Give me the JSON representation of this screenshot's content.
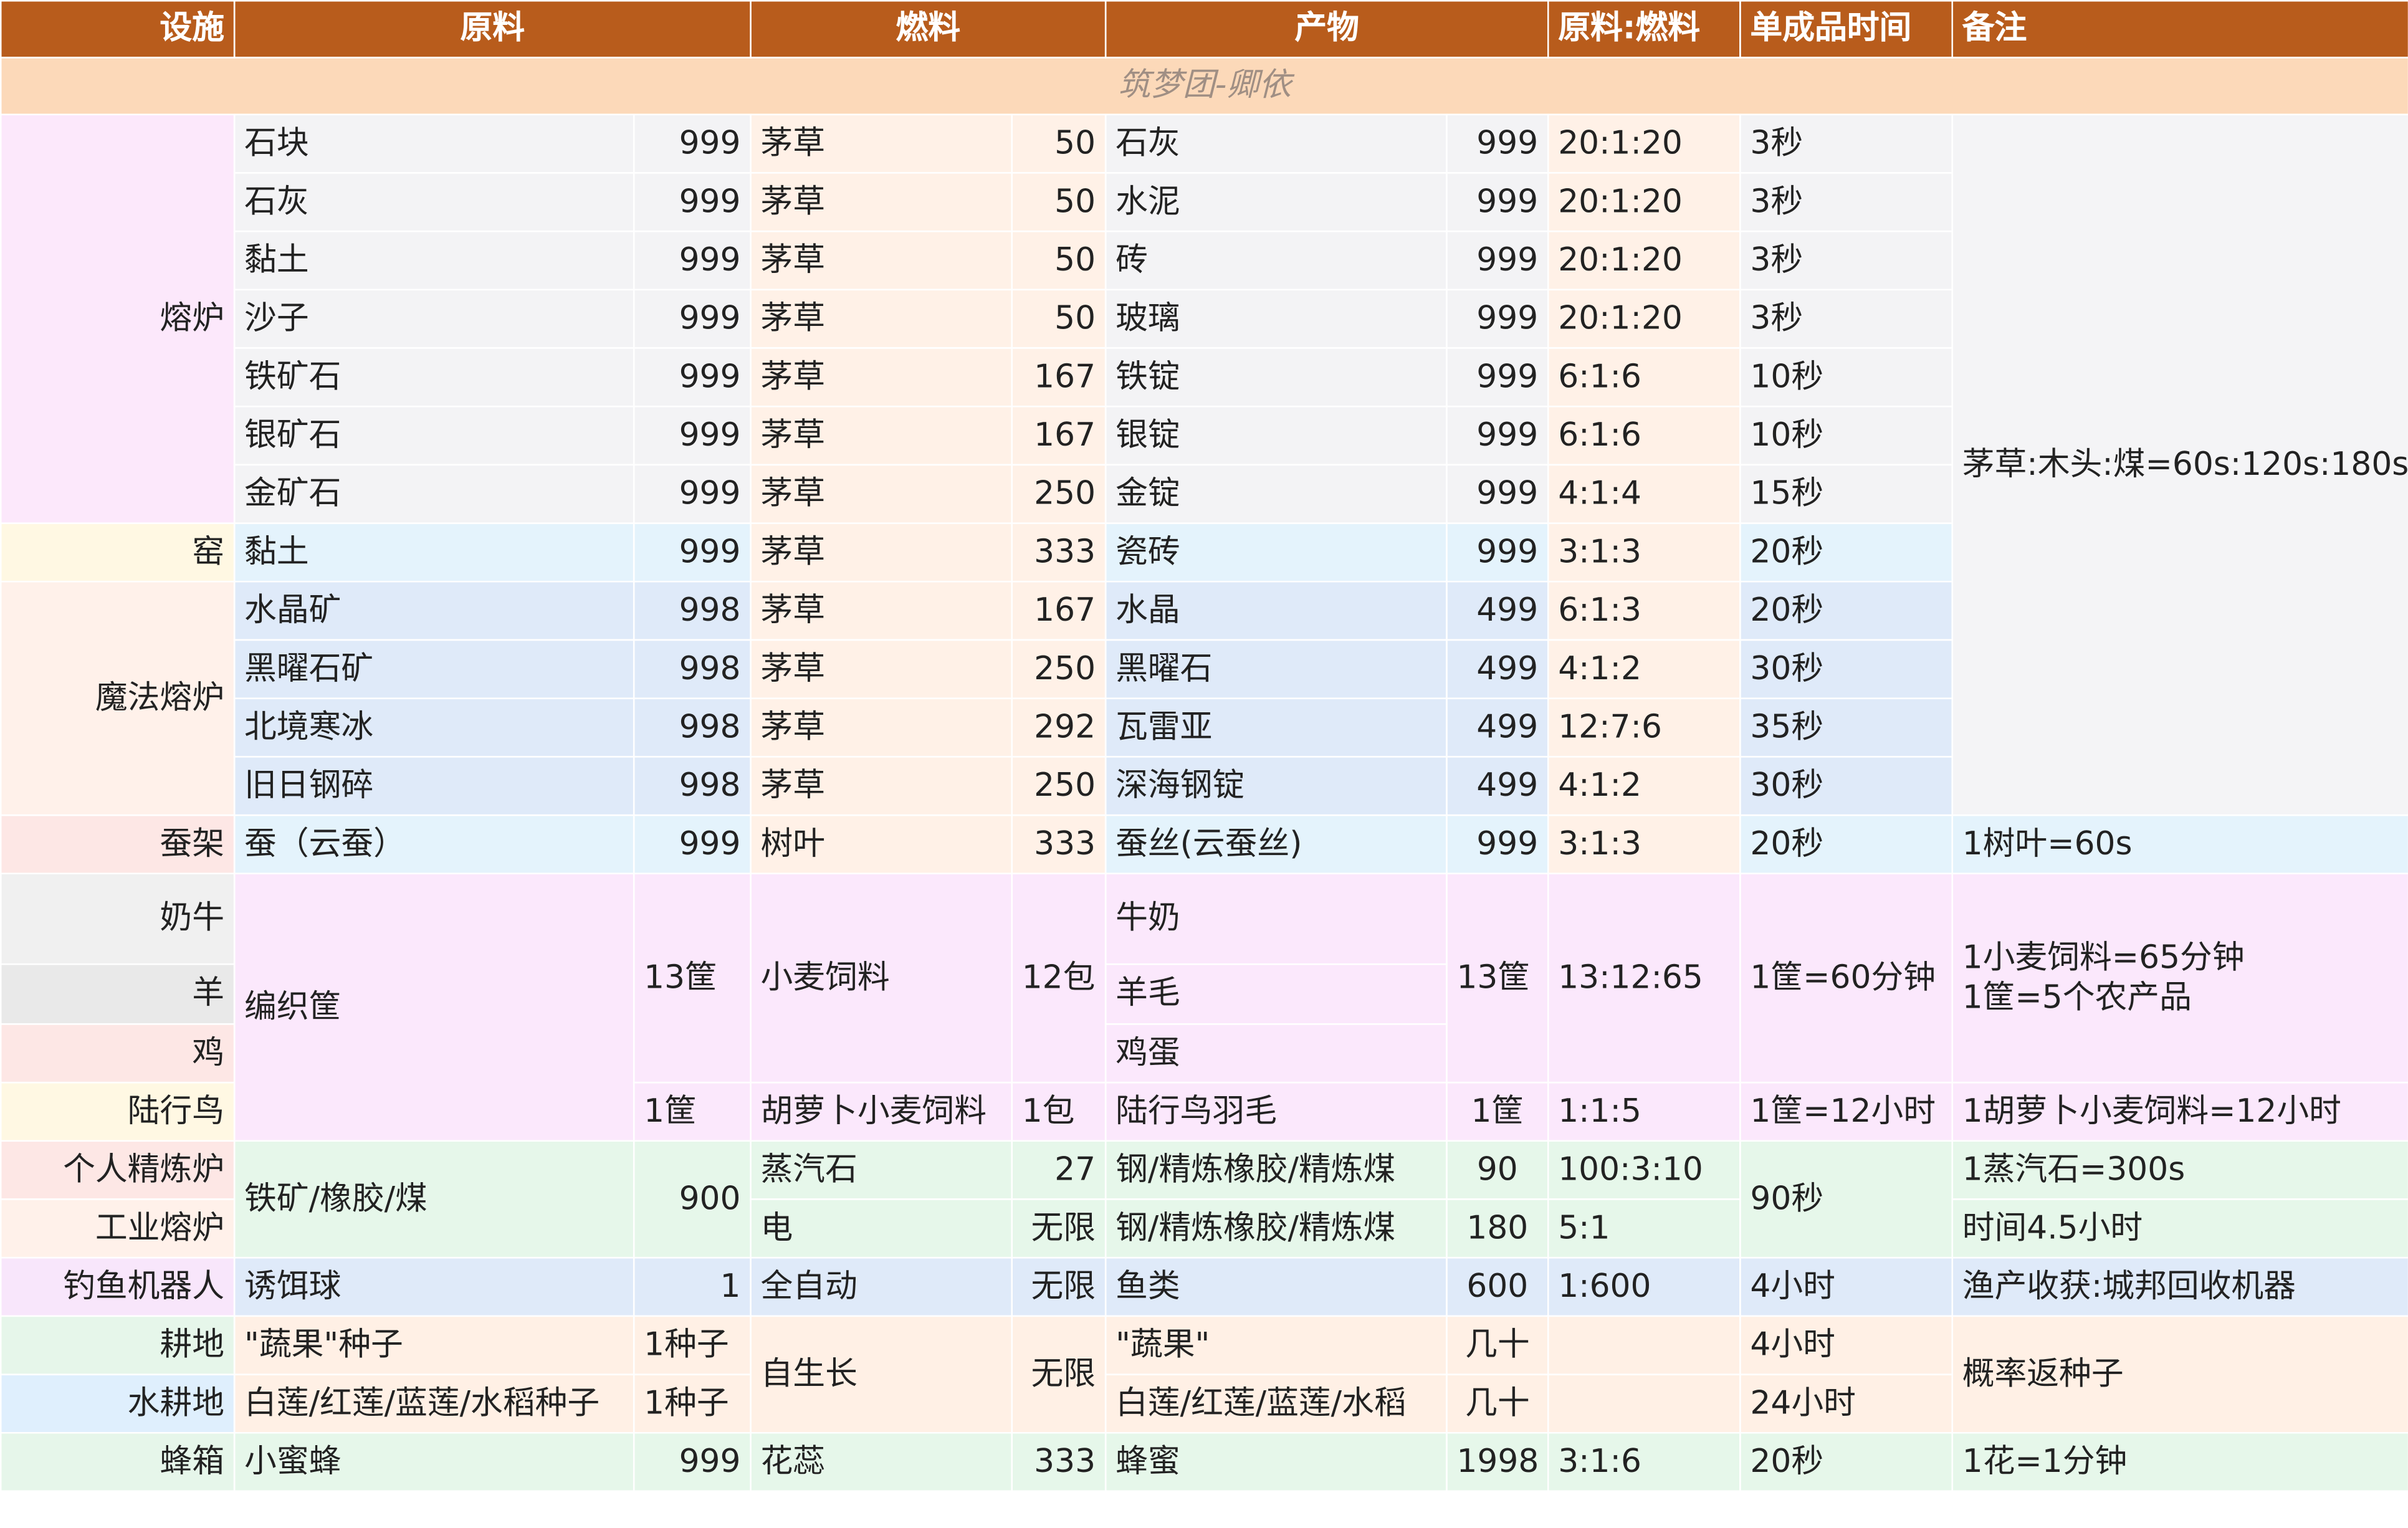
{
  "header": {
    "facility": "设施",
    "material": "原料",
    "fuel": "燃料",
    "product": "产物",
    "ratio": "原料:燃料",
    "time": "单成品时间",
    "note": "备注"
  },
  "subtitle": "筑梦团-卿依",
  "rows": {
    "r1": {
      "facility": "熔炉",
      "mat": "石块",
      "matq": "999",
      "fuel": "茅草",
      "fuelq": "50",
      "prod": "石灰",
      "prodq": "999",
      "ratio": "20:1:20",
      "time": "3秒"
    },
    "r2": {
      "mat": "石灰",
      "matq": "999",
      "fuel": "茅草",
      "fuelq": "50",
      "prod": "水泥",
      "prodq": "999",
      "ratio": "20:1:20",
      "time": "3秒"
    },
    "r3": {
      "mat": "黏土",
      "matq": "999",
      "fuel": "茅草",
      "fuelq": "50",
      "prod": "砖",
      "prodq": "999",
      "ratio": "20:1:20",
      "time": "3秒"
    },
    "r4": {
      "mat": "沙子",
      "matq": "999",
      "fuel": "茅草",
      "fuelq": "50",
      "prod": "玻璃",
      "prodq": "999",
      "ratio": "20:1:20",
      "time": "3秒"
    },
    "r5": {
      "mat": "铁矿石",
      "matq": "999",
      "fuel": "茅草",
      "fuelq": "167",
      "prod": "铁锭",
      "prodq": "999",
      "ratio": "6:1:6",
      "time": "10秒"
    },
    "r6": {
      "mat": "银矿石",
      "matq": "999",
      "fuel": "茅草",
      "fuelq": "167",
      "prod": "银锭",
      "prodq": "999",
      "ratio": "6:1:6",
      "time": "10秒"
    },
    "r7": {
      "mat": "金矿石",
      "matq": "999",
      "fuel": "茅草",
      "fuelq": "250",
      "prod": "金锭",
      "prodq": "999",
      "ratio": "4:1:4",
      "time": "15秒"
    },
    "r8": {
      "facility": "窑",
      "mat": "黏土",
      "matq": "999",
      "fuel": "茅草",
      "fuelq": "333",
      "prod": "瓷砖",
      "prodq": "999",
      "ratio": "3:1:3",
      "time": "20秒"
    },
    "r9": {
      "facility": "魔法熔炉",
      "mat": "水晶矿",
      "matq": "998",
      "fuel": "茅草",
      "fuelq": "167",
      "prod": "水晶",
      "prodq": "499",
      "ratio": "6:1:3",
      "time": "20秒"
    },
    "r10": {
      "mat": "黑曜石矿",
      "matq": "998",
      "fuel": "茅草",
      "fuelq": "250",
      "prod": "黑曜石",
      "prodq": "499",
      "ratio": "4:1:2",
      "time": "30秒"
    },
    "r11": {
      "mat": "北境寒冰",
      "matq": "998",
      "fuel": "茅草",
      "fuelq": "292",
      "prod": "瓦雷亚",
      "prodq": "499",
      "ratio": "12:7:6",
      "time": "35秒"
    },
    "r12": {
      "mat": "旧日钢碎",
      "matq": "998",
      "fuel": "茅草",
      "fuelq": "250",
      "prod": "深海钢锭",
      "prodq": "499",
      "ratio": "4:1:2",
      "time": "30秒"
    },
    "note_furnace": "茅草:木头:煤=60s:120s:180s",
    "r13": {
      "facility": "蚕架",
      "mat": "蚕（云蚕）",
      "matq": "999",
      "fuel": "树叶",
      "fuelq": "333",
      "prod": "蚕丝(云蚕丝)",
      "prodq": "999",
      "ratio": "3:1:3",
      "time": "20秒",
      "note": "1树叶=60s"
    },
    "farm": {
      "cow": "奶牛",
      "sheep": "羊",
      "chicken": "鸡",
      "mat": "编织筐",
      "matq": "13筐",
      "fuel": "小麦饲料",
      "fuelq": "12包",
      "milk": "牛奶",
      "wool": "羊毛",
      "egg": "鸡蛋",
      "prodq": "13筐",
      "ratio": "13:12:65",
      "time": "1筐=60分钟",
      "note1": "1小麦饲料=65分钟",
      "note2": "1筐=5个农产品"
    },
    "ostrich": {
      "facility": "陆行鸟",
      "matq": "1筐",
      "fuel": "胡萝卜小麦饲料",
      "fuelq": "1包",
      "prod": "陆行鸟羽毛",
      "prodq": "1筐",
      "ratio": "1:1:5",
      "time": "1筐=12小时",
      "note": "1胡萝卜小麦饲料=12小时"
    },
    "refine": {
      "facility": "个人精炼炉",
      "mat": "铁矿/橡胶/煤",
      "matq": "900",
      "fuel": "蒸汽石",
      "fuelq": "27",
      "prod": "钢/精炼橡胶/精炼煤",
      "prodq": "90",
      "ratio": "100:3:10",
      "time": "90秒",
      "note": "1蒸汽石=300s"
    },
    "industrial": {
      "facility": "工业熔炉",
      "fuel": "电",
      "fuelq": "无限",
      "prod": "钢/精炼橡胶/精炼煤",
      "prodq": "180",
      "ratio": "5:1",
      "note": "时间4.5小时"
    },
    "fishing": {
      "facility": "钓鱼机器人",
      "mat": "诱饵球",
      "matq": "1",
      "fuel": "全自动",
      "fuelq": "无限",
      "prod": "鱼类",
      "prodq": "600",
      "ratio": "1:600",
      "time": "4小时",
      "note": "渔产收获:城邦回收机器"
    },
    "field": {
      "facility": "耕地",
      "mat": "\"蔬果\"种子",
      "matq": "1种子",
      "fuel": "自生长",
      "fuelq": "无限",
      "prod": "\"蔬果\"",
      "prodq": "几十",
      "time": "4小时",
      "note": "概率返种子"
    },
    "paddy": {
      "facility": "水耕地",
      "mat": "白莲/红莲/蓝莲/水稻种子",
      "matq": "1种子",
      "prod": "白莲/红莲/蓝莲/水稻",
      "prodq": "几十",
      "time": "24小时"
    },
    "bee": {
      "facility": "蜂箱",
      "mat": "小蜜蜂",
      "matq": "999",
      "fuel": "花蕊",
      "fuelq": "333",
      "prod": "蜂蜜",
      "prodq": "1998",
      "ratio": "3:1:6",
      "time": "20秒",
      "note": "1花=1分钟"
    }
  }
}
